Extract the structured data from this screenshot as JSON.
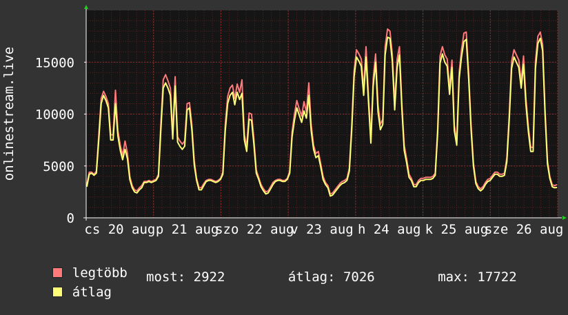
{
  "chart_data": {
    "type": "line",
    "ylabel": "onlinestream.live",
    "ylim": [
      0,
      20000
    ],
    "y_ticks": [
      0,
      5000,
      10000,
      15000
    ],
    "y_tick_labels": [
      "0",
      "5000",
      "10000",
      "15000"
    ],
    "x_tick_labels": [
      "cs 20 aug",
      "p 21 aug",
      "szo 22 aug",
      "v 23 aug",
      "h 24 aug",
      "k 25 aug",
      "sze 26 aug"
    ],
    "grid": true,
    "series": [
      {
        "name": "legtöbb",
        "color": "#ff7b7b",
        "values": [
          3200,
          4400,
          4400,
          4200,
          4500,
          8000,
          11500,
          12200,
          11700,
          11000,
          8000,
          8000,
          12300,
          8400,
          7000,
          6000,
          7400,
          6200,
          4000,
          3100,
          2700,
          2600,
          2900,
          3100,
          3500,
          3500,
          3600,
          3500,
          3600,
          3700,
          4200,
          9000,
          13300,
          13800,
          13200,
          12500,
          8100,
          13600,
          7800,
          7400,
          7100,
          7400,
          11000,
          11100,
          9000,
          5500,
          3800,
          2900,
          2900,
          3300,
          3600,
          3700,
          3700,
          3600,
          3500,
          3600,
          3800,
          4400,
          9000,
          11700,
          12500,
          12800,
          11500,
          12900,
          12100,
          13300,
          8000,
          6900,
          10100,
          10000,
          7600,
          4600,
          3900,
          3200,
          2800,
          2500,
          2600,
          3000,
          3400,
          3600,
          3700,
          3700,
          3600,
          3600,
          3800,
          4500,
          8300,
          10000,
          11300,
          10500,
          9800,
          11200,
          10200,
          13000,
          9000,
          7000,
          6200,
          6400,
          5200,
          4000,
          3400,
          3100,
          2300,
          2400,
          2700,
          3000,
          3300,
          3500,
          3600,
          3800,
          4800,
          9000,
          14200,
          16200,
          15800,
          15300,
          12400,
          16500,
          11800,
          7700,
          13400,
          15800,
          10900,
          9000,
          9500,
          16500,
          18200,
          18000,
          15800,
          11000,
          15300,
          16500,
          11000,
          7000,
          5700,
          4200,
          3800,
          3200,
          3200,
          3600,
          3800,
          3800,
          3900,
          3900,
          3900,
          4000,
          4300,
          8600,
          15600,
          16500,
          15700,
          15300,
          12500,
          15200,
          8900,
          7400,
          14000,
          16200,
          17800,
          17900,
          14000,
          9000,
          5300,
          3500,
          3000,
          2800,
          3000,
          3400,
          3700,
          3800,
          4100,
          4400,
          4400,
          4200,
          4200,
          4300,
          5800,
          10000,
          15100,
          16200,
          15700,
          15200,
          13100,
          15600,
          11500,
          8800,
          6800,
          6800,
          15100,
          17500,
          17900,
          16700,
          10500,
          5500,
          4000,
          3200,
          3100,
          3200
        ]
      },
      {
        "name": "átlag",
        "color": "#ffff77",
        "values": [
          3000,
          4200,
          4300,
          4100,
          4300,
          7500,
          11000,
          11800,
          11300,
          10600,
          7500,
          7500,
          11000,
          7900,
          6500,
          5600,
          6600,
          5700,
          3700,
          2900,
          2500,
          2400,
          2700,
          2900,
          3400,
          3400,
          3500,
          3400,
          3500,
          3600,
          4000,
          8400,
          12500,
          13000,
          12500,
          11800,
          7600,
          12700,
          7300,
          6900,
          6600,
          6900,
          10400,
          10600,
          8500,
          5100,
          3600,
          2700,
          2700,
          3100,
          3500,
          3600,
          3600,
          3500,
          3400,
          3500,
          3700,
          4200,
          8400,
          11000,
          11800,
          12100,
          10900,
          12100,
          11400,
          12000,
          7500,
          6400,
          9500,
          9400,
          7100,
          4300,
          3700,
          3000,
          2600,
          2300,
          2400,
          2800,
          3200,
          3500,
          3600,
          3600,
          3500,
          3500,
          3700,
          4300,
          7800,
          9400,
          10600,
          9900,
          9200,
          10300,
          9600,
          11800,
          8400,
          6600,
          5800,
          6000,
          4900,
          3700,
          3200,
          2900,
          2100,
          2200,
          2500,
          2800,
          3100,
          3300,
          3400,
          3600,
          4500,
          8500,
          13600,
          15500,
          15100,
          14600,
          11800,
          15500,
          11200,
          7200,
          12700,
          15000,
          10200,
          8500,
          9000,
          15700,
          17400,
          17300,
          15100,
          10400,
          14500,
          15700,
          10500,
          6500,
          5300,
          3900,
          3600,
          3000,
          3000,
          3400,
          3600,
          3600,
          3700,
          3700,
          3700,
          3800,
          4100,
          8100,
          14900,
          15800,
          15000,
          14600,
          11900,
          14500,
          8400,
          7000,
          13400,
          15500,
          17000,
          17200,
          13400,
          8500,
          5000,
          3300,
          2800,
          2600,
          2800,
          3200,
          3500,
          3600,
          3900,
          4200,
          4200,
          4000,
          4000,
          4100,
          5400,
          9500,
          14400,
          15500,
          15000,
          14500,
          12500,
          14800,
          10900,
          8300,
          6400,
          6400,
          14400,
          16800,
          17300,
          16100,
          10000,
          5200,
          3800,
          3000,
          2900,
          2922
        ]
      }
    ]
  },
  "legend": {
    "max_label": "legtöbb",
    "avg_label": "átlag",
    "max_color": "#ff7b7b",
    "avg_color": "#ffff77",
    "stats": "most: 2922        átlag: 7026        max: 17722"
  }
}
